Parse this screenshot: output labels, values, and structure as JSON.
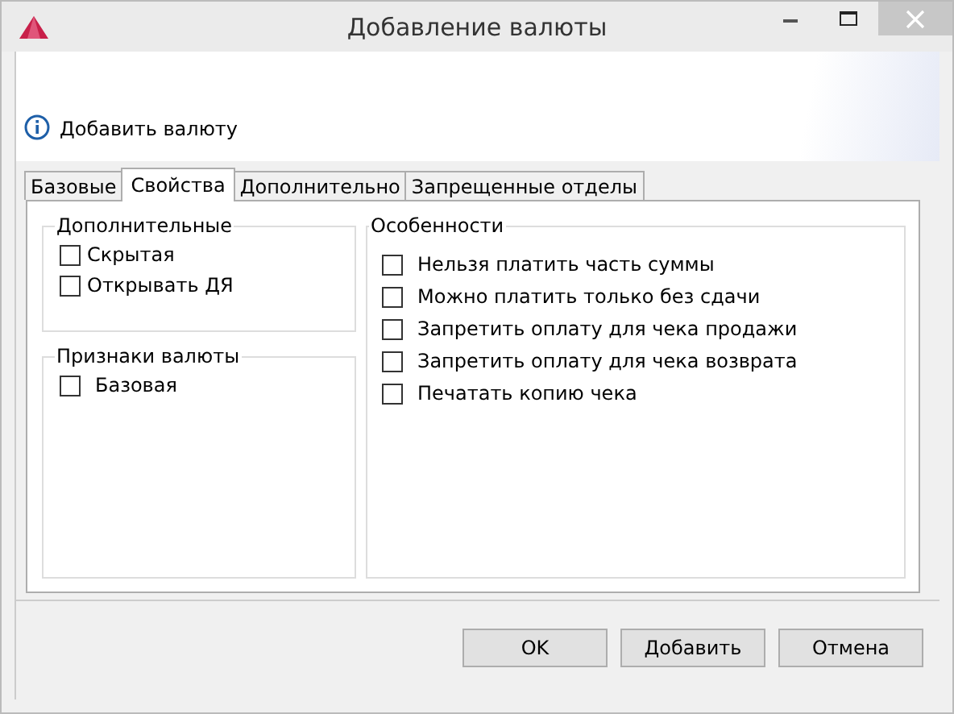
{
  "window": {
    "title": "Добавление валюты"
  },
  "header": {
    "message": "Добавить валюту"
  },
  "tabs": [
    {
      "label": "Базовые",
      "selected": false
    },
    {
      "label": "Свойства",
      "selected": true
    },
    {
      "label": "Дополнительно",
      "selected": false
    },
    {
      "label": "Запрещенные отделы",
      "selected": false
    }
  ],
  "groups_left": [
    {
      "title": "Дополнительные",
      "options": [
        {
          "label": "Скрытая",
          "checked": false
        },
        {
          "label": "Открывать ДЯ",
          "checked": false
        }
      ]
    },
    {
      "title": "Признаки валюты",
      "options": [
        {
          "label": "Базовая",
          "checked": false
        }
      ]
    }
  ],
  "group_right": {
    "title": "Особенности",
    "options": [
      {
        "label": "Нельзя платить часть суммы",
        "checked": false
      },
      {
        "label": "Можно платить только без сдачи",
        "checked": false
      },
      {
        "label": "Запретить оплату для чека продажи",
        "checked": false
      },
      {
        "label": "Запретить оплату для чека возврата",
        "checked": false
      },
      {
        "label": "Печатать копию чека",
        "checked": false
      }
    ]
  },
  "buttons": [
    "OK",
    "Добавить",
    "Отмена"
  ]
}
